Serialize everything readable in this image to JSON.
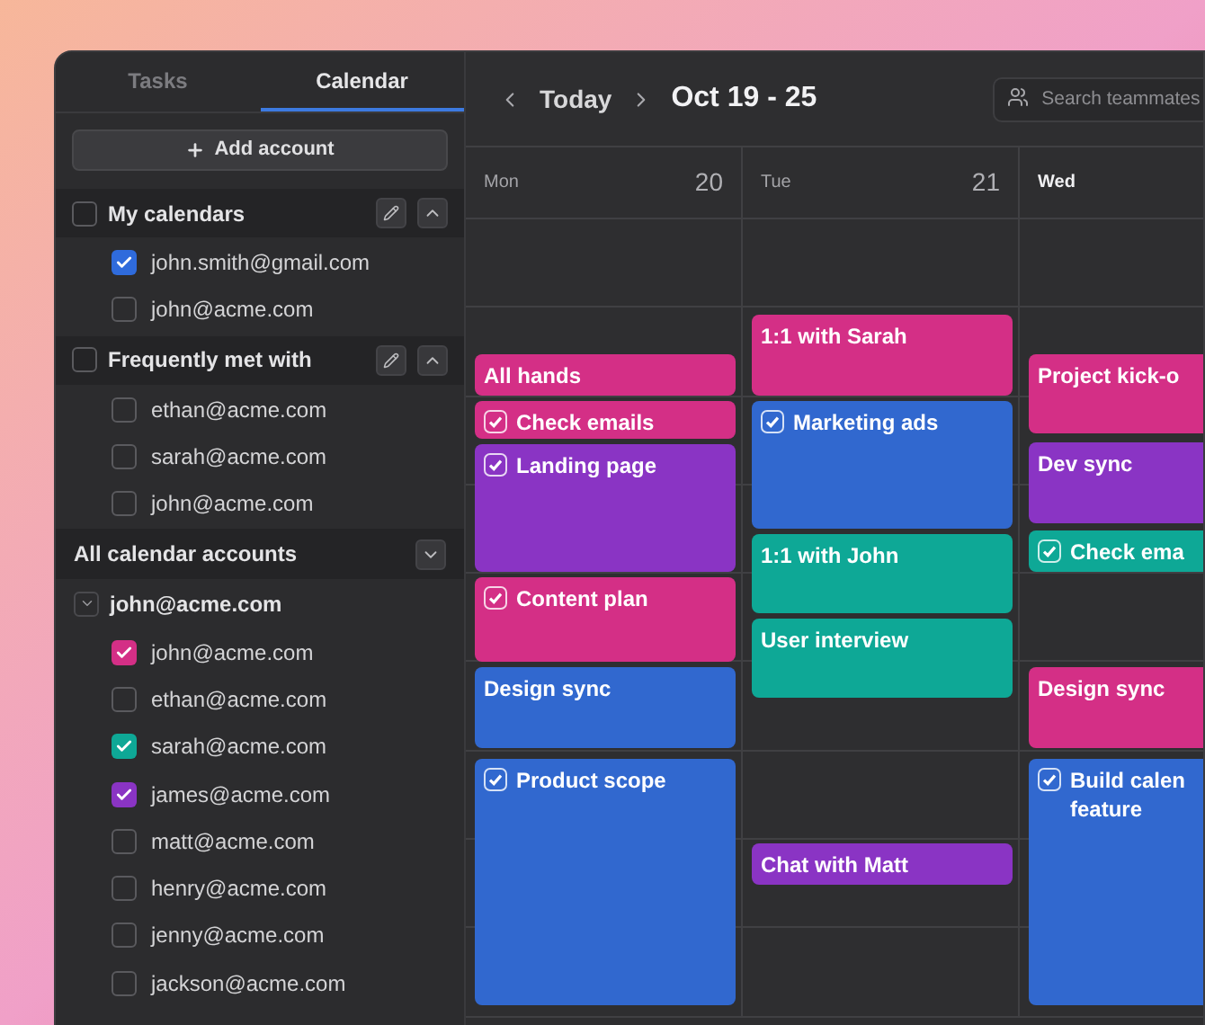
{
  "sidebar": {
    "tabs": [
      {
        "label": "Tasks",
        "selected": false
      },
      {
        "label": "Calendar",
        "selected": true
      }
    ],
    "add_account": "Add account",
    "groups": [
      {
        "title": "My calendars",
        "checked": false,
        "items": [
          {
            "email": "john.smith@gmail.com",
            "checked": true,
            "color": "#2f6bdc"
          },
          {
            "email": "john@acme.com",
            "checked": false
          }
        ]
      },
      {
        "title": "Frequently met with",
        "checked": false,
        "items": [
          {
            "email": "ethan@acme.com",
            "checked": false
          },
          {
            "email": "sarah@acme.com",
            "checked": false
          },
          {
            "email": "john@acme.com",
            "checked": false
          }
        ]
      }
    ],
    "accounts_section": {
      "title": "All calendar accounts",
      "accounts": [
        {
          "email": "john@acme.com",
          "expanded": true,
          "calendars": [
            {
              "email": "john@acme.com",
              "checked": true,
              "color": "#d42f86"
            },
            {
              "email": "ethan@acme.com",
              "checked": false
            },
            {
              "email": "sarah@acme.com",
              "checked": true,
              "color": "#0ea896"
            },
            {
              "email": "james@acme.com",
              "checked": true,
              "color": "#8a34c4"
            },
            {
              "email": "matt@acme.com",
              "checked": false
            },
            {
              "email": "henry@acme.com",
              "checked": false
            },
            {
              "email": "jenny@acme.com",
              "checked": false
            },
            {
              "email": "jackson@acme.com",
              "checked": false
            }
          ]
        }
      ]
    }
  },
  "header": {
    "today": "Today",
    "range": "Oct 19 - 25",
    "search": {
      "placeholder": "Search teammates"
    }
  },
  "days": [
    {
      "weekday": "Mon",
      "date": "20",
      "today": false,
      "events": [
        {
          "title": "All hands",
          "color": "#d42f86",
          "task": false
        },
        {
          "title": "Check emails",
          "color": "#d42f86",
          "task": true
        },
        {
          "title": "Landing page",
          "color": "#8a34c4",
          "task": true
        },
        {
          "title": "Content plan",
          "color": "#d42f86",
          "task": true
        },
        {
          "title": "Design sync",
          "color": "#3168cf",
          "task": false
        },
        {
          "title": "Product scope",
          "color": "#3168cf",
          "task": true
        }
      ]
    },
    {
      "weekday": "Tue",
      "date": "21",
      "today": false,
      "events": [
        {
          "title": "1:1 with Sarah",
          "color": "#d42f86",
          "task": false
        },
        {
          "title": "Marketing ads",
          "color": "#3168cf",
          "task": true
        },
        {
          "title": "1:1 with John",
          "color": "#0ea896",
          "task": false
        },
        {
          "title": "User interview",
          "color": "#0ea896",
          "task": false
        },
        {
          "title": "Chat with Matt",
          "color": "#8a34c4",
          "task": false
        }
      ]
    },
    {
      "weekday": "Wed",
      "today": true,
      "events": [
        {
          "title": "Project kick-o",
          "color": "#d42f86",
          "task": false
        },
        {
          "title": "Dev sync",
          "color": "#8a34c4",
          "task": false
        },
        {
          "title": "Check ema",
          "color": "#0ea896",
          "task": true
        },
        {
          "title": "Design sync",
          "color": "#d42f86",
          "task": false
        },
        {
          "title": "Build calen feature",
          "color": "#3168cf",
          "task": true
        }
      ]
    }
  ]
}
